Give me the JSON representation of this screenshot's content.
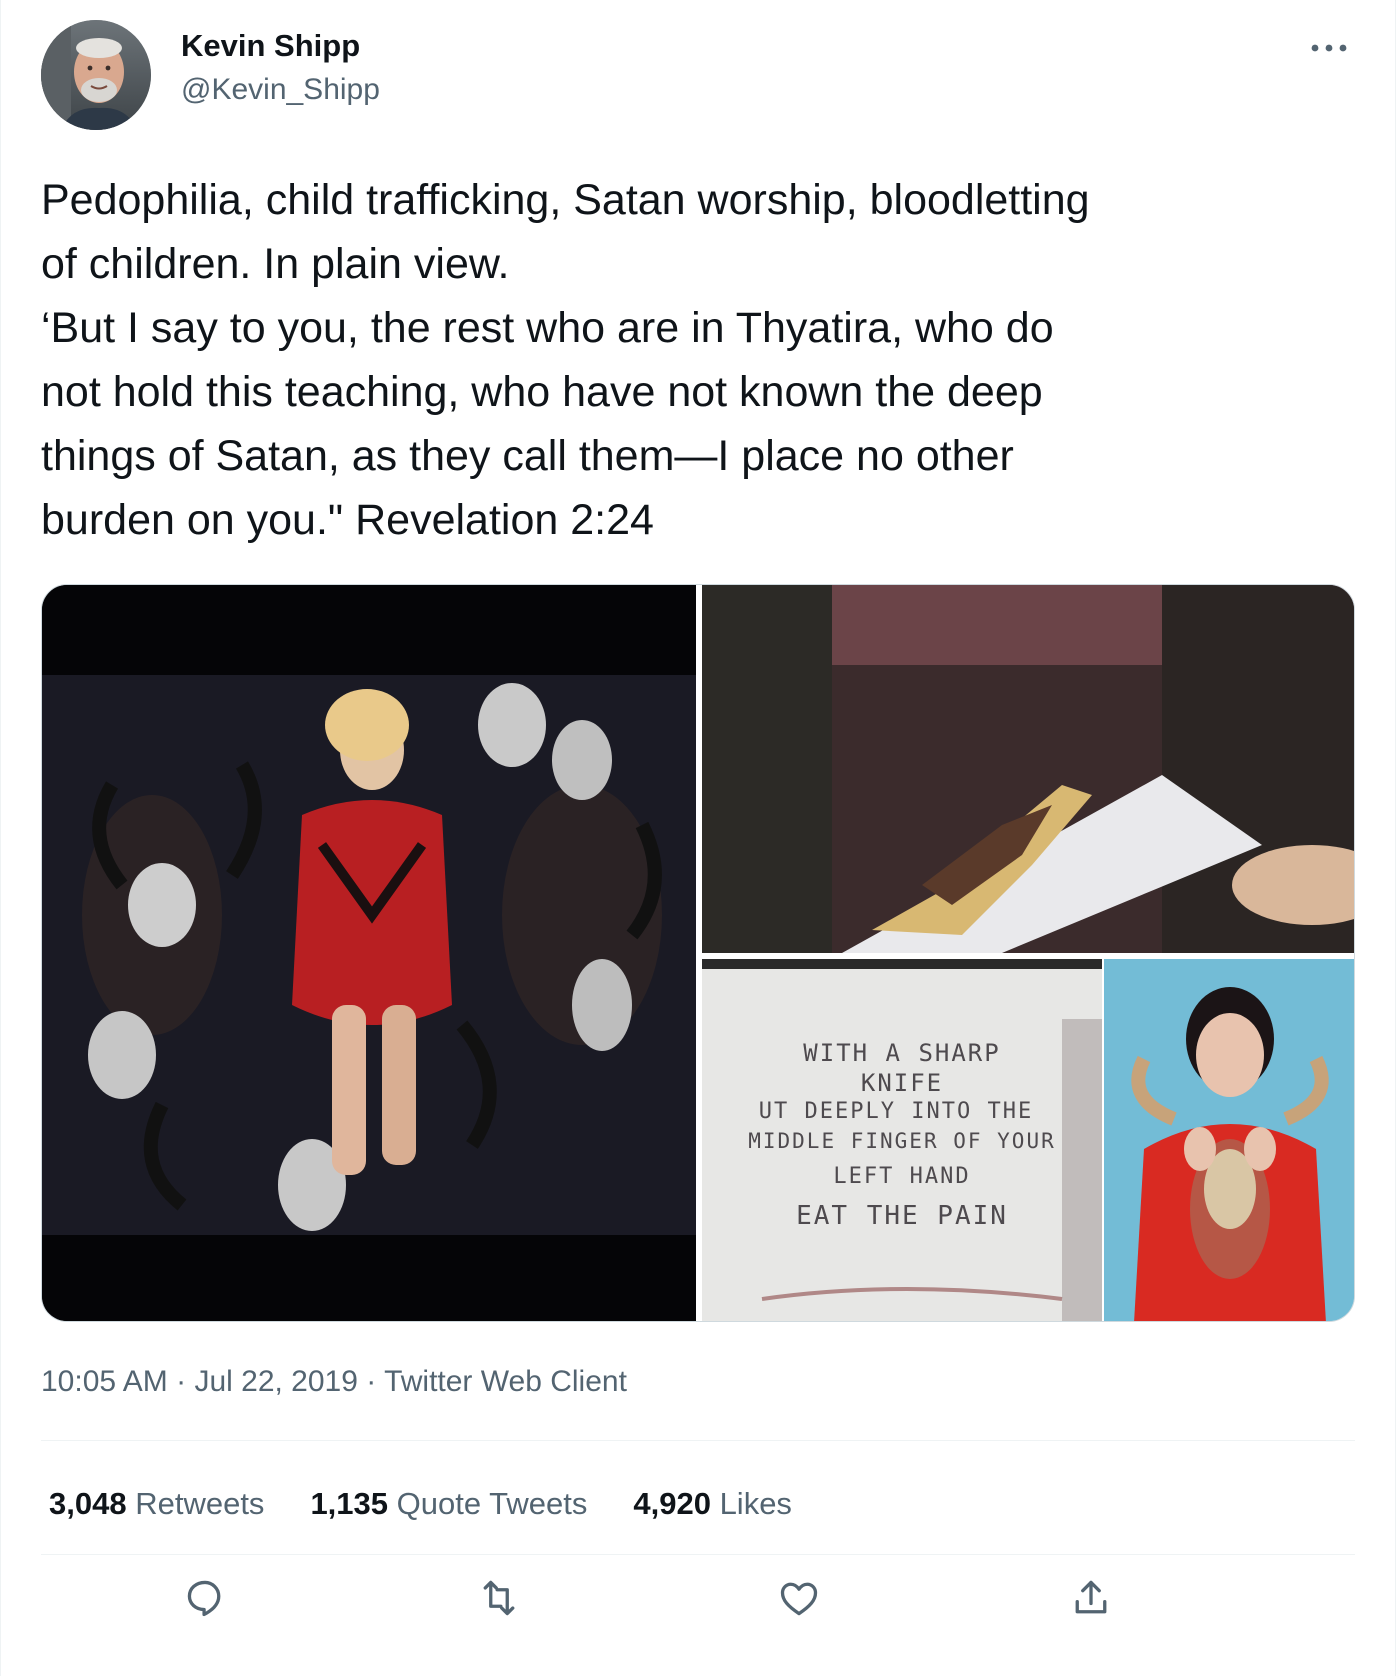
{
  "author": {
    "display_name": "Kevin Shipp",
    "handle": "@Kevin_Shipp"
  },
  "tweet": {
    "lines": [
      "Pedophilia, child trafficking, Satan worship, bloodletting",
      "of children. In plain view.",
      "‘But I say to you, the rest who are in Thyatira, who do",
      "not hold this teaching, who have not known the deep",
      "things of Satan, as they call them—I place no other",
      "burden on you.\" Revelation 2:24"
    ]
  },
  "media": {
    "image_3_text": [
      "WITH A SHARP",
      "KNIFE",
      "UT DEEPLY INTO THE",
      "MIDDLE FINGER OF YOUR",
      "LEFT HAND",
      "EAT THE PAIN"
    ]
  },
  "meta": {
    "time": "10:05 AM",
    "separator": "·",
    "date": "Jul 22, 2019",
    "source": "Twitter Web Client"
  },
  "stats": {
    "retweets": {
      "count": "3,048",
      "label": "Retweets"
    },
    "quotes": {
      "count": "1,135",
      "label": "Quote Tweets"
    },
    "likes": {
      "count": "4,920",
      "label": "Likes"
    }
  },
  "icons": {
    "more": "more-horizontal-icon",
    "reply": "reply-icon",
    "retweet": "retweet-icon",
    "like": "heart-icon",
    "share": "share-icon"
  },
  "colors": {
    "text_primary": "#0f1419",
    "text_secondary": "#536471",
    "border": "#cfd9de",
    "divider": "#eff3f4"
  }
}
